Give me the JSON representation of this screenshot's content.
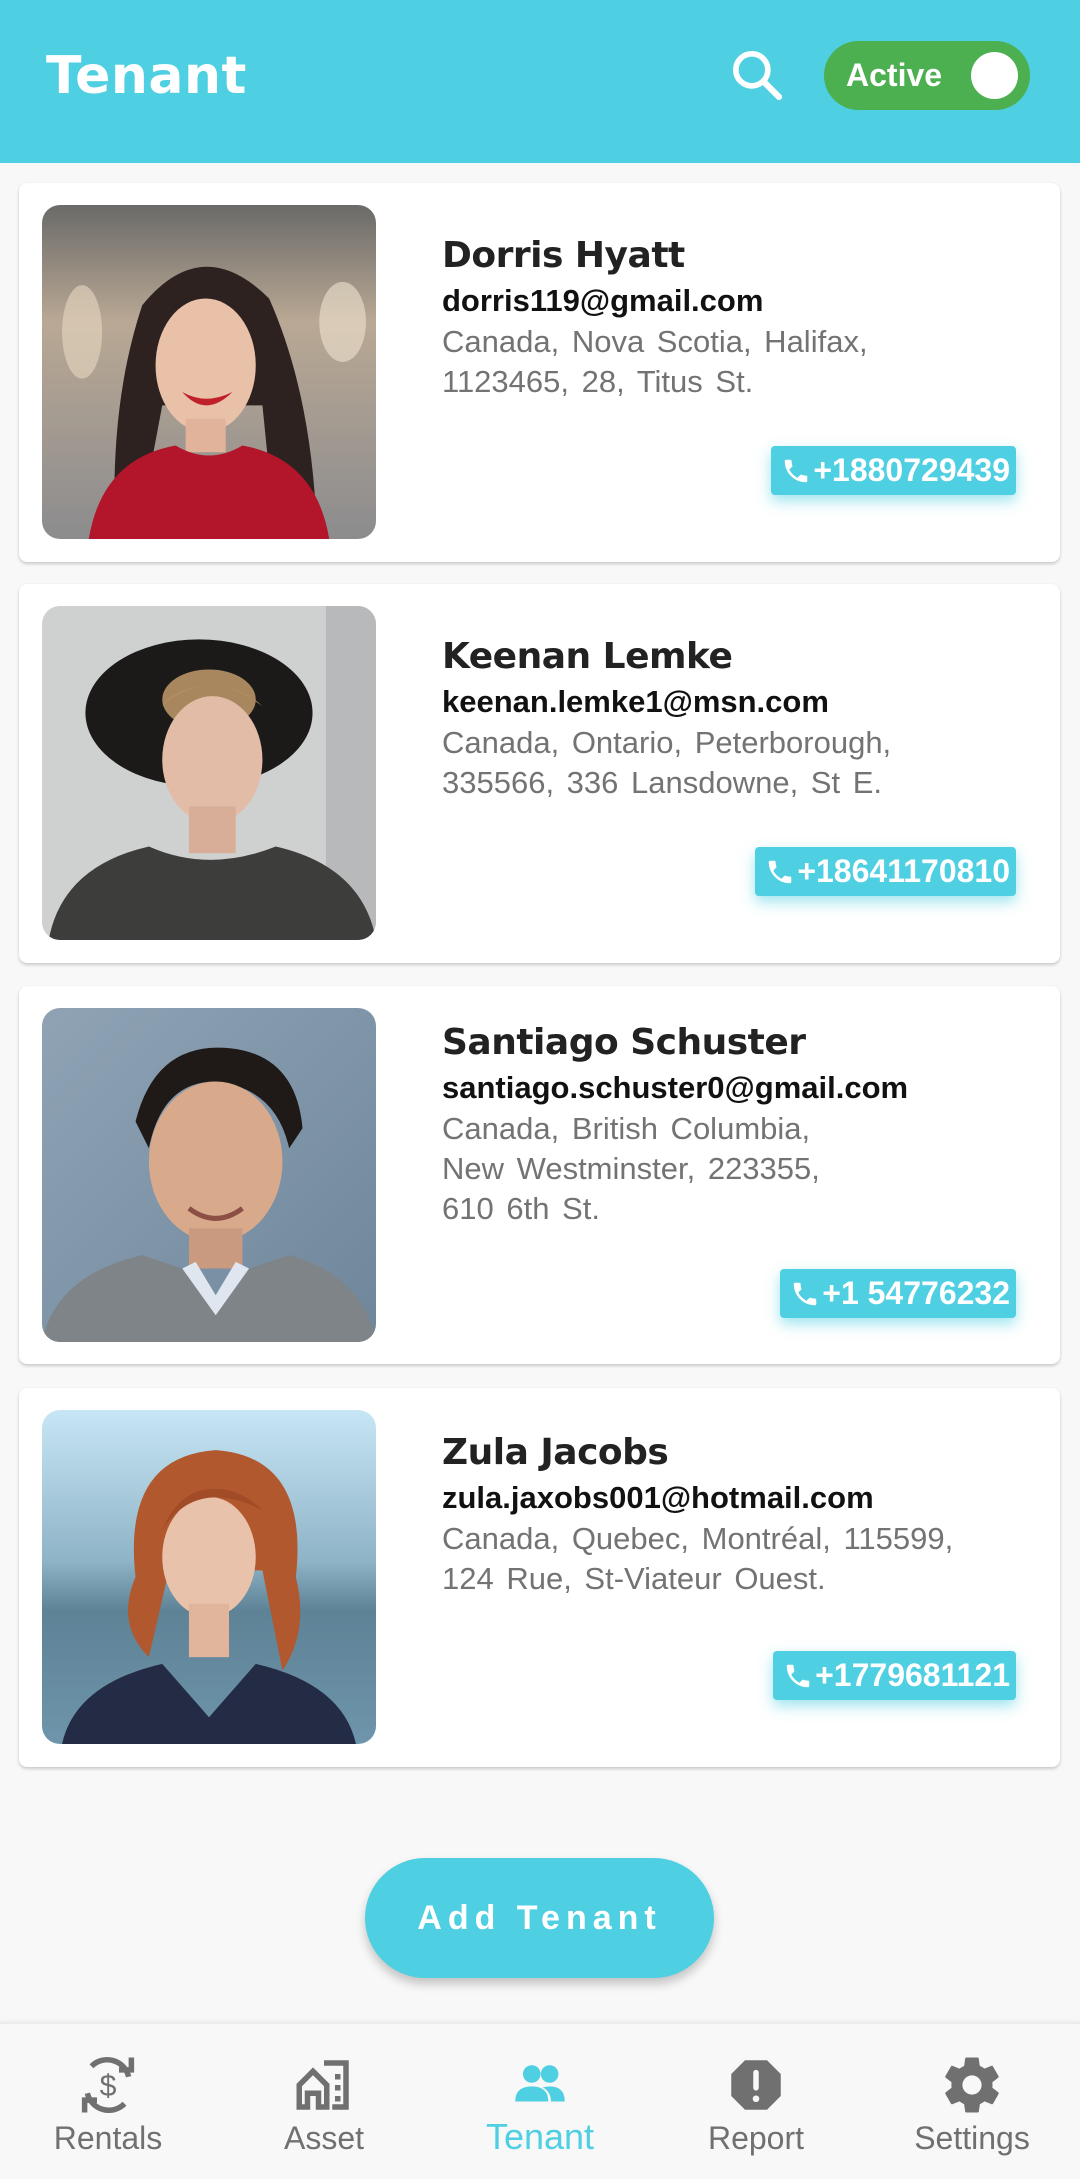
{
  "appbar": {
    "title": "Tenant",
    "search_icon": "search-icon",
    "status_toggle": {
      "label": "Active",
      "on": true
    }
  },
  "colors": {
    "primary": "#4fcfe2",
    "toggle_on": "#4caf50",
    "nav_inactive": "#707070",
    "address_text": "#737373"
  },
  "tenants": [
    {
      "name": "Dorris Hyatt",
      "email": "dorris119@gmail.com",
      "address_lines": [
        "Canada,  Nova Scotia,  Halifax,",
        "1123465,  28,  Titus St."
      ],
      "phone": "+1880729439",
      "photo": "woman-dark-hair-red-top"
    },
    {
      "name": "Keenan Lemke",
      "email": "keenan.lemke1@msn.com",
      "address_lines": [
        "Canada,  Ontario,  Peterborough,",
        "335566,  336 Lansdowne,  St E."
      ],
      "phone": "+18641170810",
      "photo": "man-curly-hair-black-hat"
    },
    {
      "name": "Santiago Schuster",
      "email": "santiago.schuster0@gmail.com",
      "address_lines": [
        "Canada,  British Columbia,",
        "New Westminster,  223355,",
        "610 6th St."
      ],
      "phone": "+1 54776232",
      "photo": "man-dark-hair-grey-sweater"
    },
    {
      "name": "Zula Jacobs",
      "email": "zula.jaxobs001@hotmail.com",
      "address_lines": [
        "Canada,  Quebec,  Montréal,  115599,",
        "124 Rue,  St-Viateur Ouest."
      ],
      "phone": "+1779681121",
      "photo": "woman-red-hair-navy-top"
    }
  ],
  "add_button": {
    "label": "Add Tenant"
  },
  "bottom_nav": {
    "active": "Tenant",
    "items": [
      {
        "label": "Rentals",
        "icon": "currency-exchange-icon"
      },
      {
        "label": "Asset",
        "icon": "home-building-icon"
      },
      {
        "label": "Tenant",
        "icon": "people-icon"
      },
      {
        "label": "Report",
        "icon": "report-octagon-icon"
      },
      {
        "label": "Settings",
        "icon": "gear-icon"
      }
    ]
  }
}
